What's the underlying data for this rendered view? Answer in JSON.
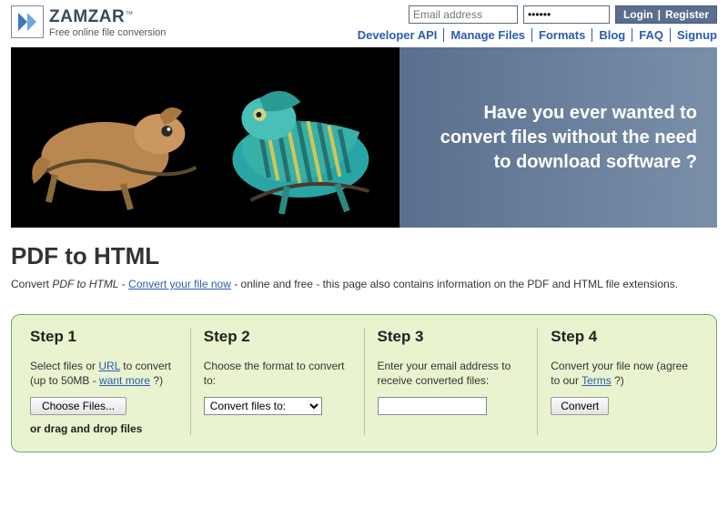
{
  "brand": {
    "name": "ZAMZAR",
    "tm": "™",
    "tagline": "Free online file conversion"
  },
  "login": {
    "email_placeholder": "Email address",
    "password_value": "••••••",
    "login_label": "Login",
    "register_label": "Register"
  },
  "nav": {
    "developer": "Developer API",
    "manage": "Manage Files",
    "formats": "Formats",
    "blog": "Blog",
    "faq": "FAQ",
    "signup": "Signup"
  },
  "banner": {
    "headline": "Have you ever wanted to convert files without the need to download software ?"
  },
  "page": {
    "title": "PDF to HTML",
    "sub_prefix": "Convert ",
    "sub_ital": "PDF to HTML",
    "sub_dash1": " - ",
    "sub_link": "Convert your file now",
    "sub_rest": " - online and free - this page also contains information on the PDF and HTML file extensions."
  },
  "steps": {
    "s1": {
      "title": "Step 1",
      "text_a": "Select files or ",
      "url_link": "URL",
      "text_b": " to convert (up to 50MB - ",
      "want_more": "want more",
      "text_c": " ?)",
      "choose_btn": "Choose Files...",
      "drag_text": "or drag and drop files"
    },
    "s2": {
      "title": "Step 2",
      "text": "Choose the format to convert to:",
      "select_default": "Convert files to:"
    },
    "s3": {
      "title": "Step 3",
      "text": "Enter your email address to receive converted files:"
    },
    "s4": {
      "title": "Step 4",
      "text_a": "Convert your file now (agree to our ",
      "terms_link": "Terms",
      "text_b": " ?)",
      "convert_btn": "Convert"
    }
  }
}
